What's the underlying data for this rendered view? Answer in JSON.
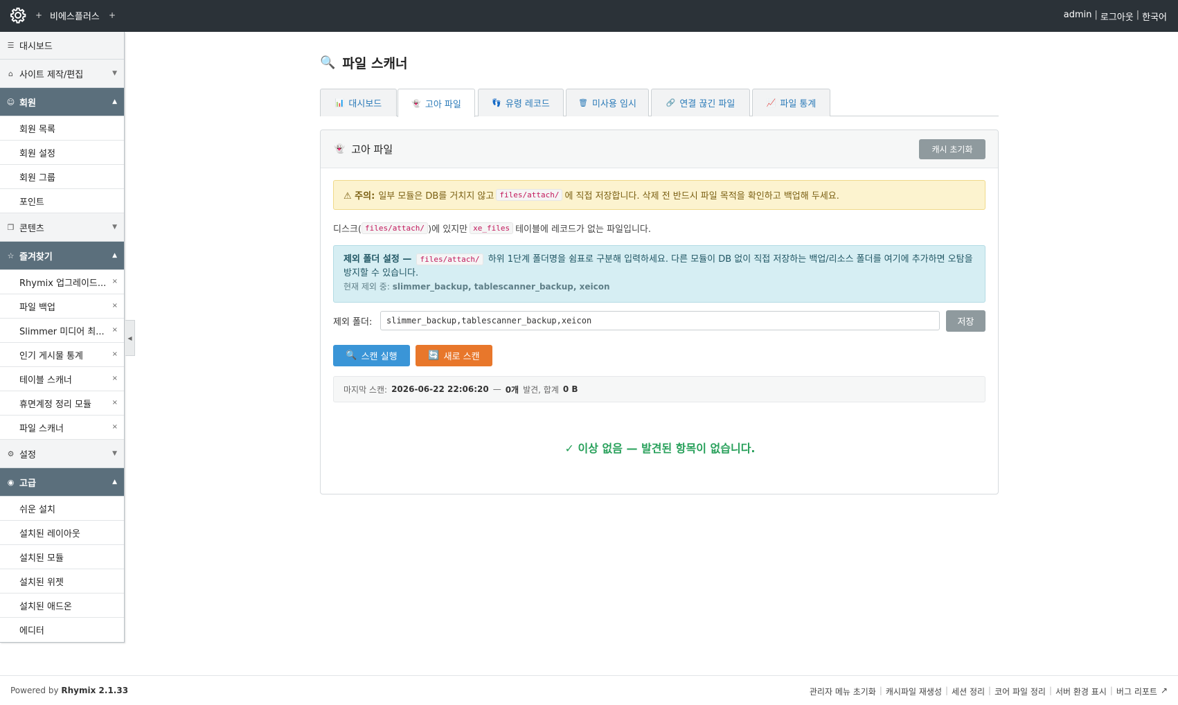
{
  "topbar": {
    "plus_left": "+",
    "site_name": "비에스플러스",
    "plus_right": "+",
    "user": "admin",
    "logout": "로그아웃",
    "language": "한국어",
    "separator": "|"
  },
  "sidebar": {
    "dashboard": "대시보드",
    "site_edit": "사이트 제작/편집",
    "member": {
      "label": "회원",
      "items": [
        "회원 목록",
        "회원 설정",
        "회원 그룹",
        "포인트"
      ]
    },
    "content": "콘텐츠",
    "favorites": {
      "label": "즐겨찾기",
      "items": [
        "Rhymix 업그레이드...",
        "파일 백업",
        "Slimmer 미디어 최...",
        "인기 게시물 통계",
        "테이블 스캐너",
        "휴면계정 정리 모듈",
        "파일 스캐너"
      ],
      "remove_glyph": "×"
    },
    "settings": "설정",
    "advanced": {
      "label": "고급",
      "items": [
        "쉬운 설치",
        "설치된 레이아웃",
        "설치된 모듈",
        "설치된 위젯",
        "설치된 애드온",
        "에디터"
      ]
    }
  },
  "page": {
    "title": "파일 스캐너",
    "tabs": [
      {
        "label": "대시보드",
        "icon": "📊"
      },
      {
        "label": "고아 파일",
        "icon": "👻"
      },
      {
        "label": "유령 레코드",
        "icon": "👣"
      },
      {
        "label": "미사용 임시",
        "icon": "🗑"
      },
      {
        "label": "연결 끊긴 파일",
        "icon": "🔗"
      },
      {
        "label": "파일 통계",
        "icon": "📈"
      }
    ],
    "active_tab": 1,
    "panel": {
      "title": "고아 파일",
      "cache_reset": "캐시 초기화",
      "warning": {
        "label": "⚠ 주의:",
        "text_before": "일부 모듈은 DB를 거치지 않고",
        "code": "files/attach/",
        "text_after": "에 직접 저장합니다. 삭제 전 반드시 파일 목적을 확인하고 백업해 두세요."
      },
      "description": {
        "p1": "디스크(",
        "code1": "files/attach/",
        "p2": ")에 있지만",
        "code2": "xe_files",
        "p3": "테이블에 레코드가 없는 파일입니다."
      },
      "exclude_info": {
        "title": "제외 폴더 설정 —",
        "code": "files/attach/",
        "text": "하위 1단계 폴더명을 쉼표로 구분해 입력하세요. 다른 모듈이 DB 없이 직접 저장하는 백업/리소스 폴더를 여기에 추가하면 오탐을 방지할 수 있습니다.",
        "current_label": "현재 제외 중:",
        "current_value": "slimmer_backup, tablescanner_backup, xeicon"
      },
      "exclude_field": {
        "label": "제외 폴더:",
        "value": "slimmer_backup,tablescanner_backup,xeicon",
        "save": "저장"
      },
      "run_scan": "스캔 실행",
      "new_scan": "새로 스캔",
      "last_scan": {
        "label": "마지막 스캔:",
        "datetime": "2026-06-22 22:06:20",
        "dash": "—",
        "count": "0개",
        "found_total": "발견, 합계",
        "size": "0 B"
      },
      "result": "✓ 이상 없음 — 발견된 항목이 없습니다."
    }
  },
  "footer": {
    "powered_by": "Powered by",
    "version": "Rhymix 2.1.33",
    "links": [
      "관리자 메뉴 초기화",
      "캐시파일 재생성",
      "세션 정리",
      "코어 파일 정리",
      "서버 환경 표시",
      "버그 리포트"
    ]
  }
}
